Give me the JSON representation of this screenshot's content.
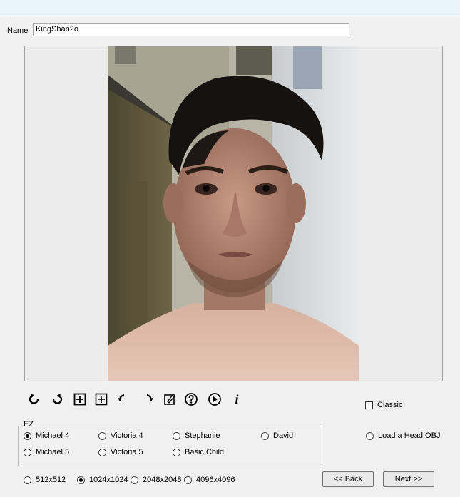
{
  "name_label": "Name",
  "name_value": "KingShan2o",
  "toolbar": {
    "icons": [
      "rotate-left-icon",
      "rotate-right-icon",
      "expand-box-icon",
      "add-box-icon",
      "undo-curve-icon",
      "redo-curve-icon",
      "note-edit-icon",
      "help-icon",
      "play-icon",
      "info-icon"
    ],
    "info_glyph": "i"
  },
  "classic": {
    "label": "Classic",
    "checked": false
  },
  "ez": {
    "title": "EZ",
    "options": [
      {
        "label": "Michael 4",
        "selected": true
      },
      {
        "label": "Victoria 4",
        "selected": false
      },
      {
        "label": "Stephanie",
        "selected": false
      },
      {
        "label": "David",
        "selected": false
      },
      {
        "label": "Michael 5",
        "selected": false
      },
      {
        "label": "Victoria 5",
        "selected": false
      },
      {
        "label": "Basic Child",
        "selected": false
      }
    ]
  },
  "load_head_obj": "Load a Head OBJ",
  "resolutions": [
    {
      "label": "512x512",
      "selected": false
    },
    {
      "label": "1024x1024",
      "selected": true
    },
    {
      "label": "2048x2048",
      "selected": false
    },
    {
      "label": "4096x4096",
      "selected": false
    }
  ],
  "buttons": {
    "back": "<< Back",
    "next": "Next >>"
  }
}
